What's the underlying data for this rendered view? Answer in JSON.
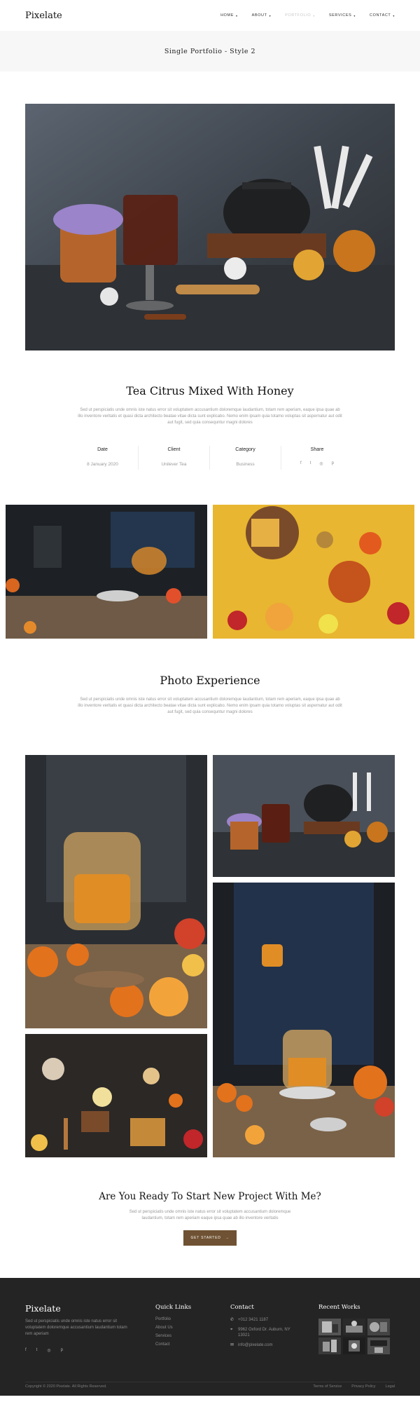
{
  "header": {
    "logo": "Pixelate",
    "nav": [
      {
        "label": "HOME",
        "active": false
      },
      {
        "label": "ABOUT",
        "active": false
      },
      {
        "label": "PORTFOLIO",
        "active": true
      },
      {
        "label": "SERVICES",
        "active": false
      },
      {
        "label": "CONTACT",
        "active": false
      }
    ]
  },
  "page_title": "Single Portfolio - Style 2",
  "project": {
    "title": "Tea Citrus Mixed With Honey",
    "description": "Sed ut perspiciatis unde omnis iste natus error sit voluptatem accusantium doloremque laudantium, totam rem aperiam, eaque ipsa quae ab illo inventore veritatis et quasi dicta architecto beatae vitae dicta sunt explicabo. Nemo enim ipsam quia totamo voluptas sit aspernatur aut odit aut fugit, sed quia consequntur magni dolores",
    "meta": {
      "date_label": "Date",
      "date_value": "8 January 2020",
      "client_label": "Client",
      "client_value": "Unilever Tea",
      "category_label": "Category",
      "category_value": "Business",
      "share_label": "Share"
    }
  },
  "experience": {
    "title": "Photo Experience",
    "description": "Sed ut perspiciatis unde omnis iste natus error sit voluptatem accusantium doloremque laudantium, totam rem aperiam, eaque ipsa quae ab illo inventore veritatis et quasi dicta architecto beatae vitae dicta sunt explicabo. Nemo enim ipsam quia totamo voluptas sit aspernatur aut odit aut fugit, sed quia consequntur magni dolores"
  },
  "cta": {
    "title": "Are You Ready To Start New Project With Me?",
    "description": "Sed ut perspiciatis unde omnis iste natus error sit voluptatem accusantium doloremque laudantium, totam rem aperiam eaque ipsa quae ab illo inventore veritatis",
    "button_label": "GET STARTED",
    "button_arrow": "→"
  },
  "footer": {
    "logo": "Pixelate",
    "about": "Sed ut perspiciatis unde omnis iste natus error sit voluptatem doloremque accusantium laudantium totam rem aperiam",
    "quick_links_title": "Quick Links",
    "quick_links": [
      "Portfolio",
      "About Us",
      "Services",
      "Contact"
    ],
    "contact_title": "Contact",
    "phone": "+012 3421 1187",
    "address": "9962 Oxford Dr. Auburn, NY 13021",
    "email": "info@pixelate.com",
    "recent_works_title": "Recent Works",
    "copyright": "Copyright © 2020 Pixelate. All Rights Reserved.",
    "legal": [
      "Terms of Service",
      "Privacy Policy",
      "Legal"
    ]
  },
  "icons": {
    "facebook": "f",
    "twitter": "t",
    "instagram": "◎",
    "pinterest": "p",
    "phone": "✆",
    "location": "⌖",
    "email": "✉",
    "caret": "▾"
  },
  "colors": {
    "accent": "#6f5233",
    "footer_bg": "#242424",
    "title_bar_bg": "#f7f7f7"
  }
}
